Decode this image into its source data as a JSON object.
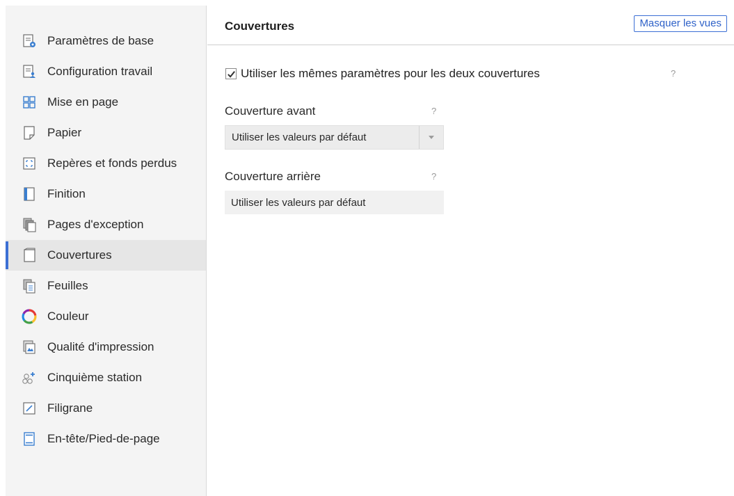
{
  "sidebar": {
    "items": [
      {
        "label": "Paramètres de base",
        "icon": "basic-settings-icon"
      },
      {
        "label": "Configuration travail",
        "icon": "job-config-icon"
      },
      {
        "label": "Mise en page",
        "icon": "layout-grid-icon"
      },
      {
        "label": "Papier",
        "icon": "paper-icon"
      },
      {
        "label": "Repères et fonds perdus",
        "icon": "marks-bleed-icon"
      },
      {
        "label": "Finition",
        "icon": "finishing-icon"
      },
      {
        "label": "Pages d'exception",
        "icon": "exception-pages-icon"
      },
      {
        "label": "Couvertures",
        "icon": "covers-icon",
        "active": true
      },
      {
        "label": "Feuilles",
        "icon": "sheets-icon"
      },
      {
        "label": "Couleur",
        "icon": "color-wheel-icon"
      },
      {
        "label": "Qualité d'impression",
        "icon": "print-quality-icon"
      },
      {
        "label": "Cinquième station",
        "icon": "fifth-station-icon"
      },
      {
        "label": "Filigrane",
        "icon": "watermark-icon"
      },
      {
        "label": "En-tête/Pied-de-page",
        "icon": "header-footer-icon"
      }
    ]
  },
  "main": {
    "title": "Couvertures",
    "hide_views_label": "Masquer les vues",
    "same_settings": {
      "label": "Utiliser les mêmes paramètres pour les deux couvertures",
      "checked": true
    },
    "help_symbol": "?",
    "front_cover": {
      "label": "Couverture avant",
      "value": "Utiliser les valeurs par défaut"
    },
    "back_cover": {
      "label": "Couverture arrière",
      "value": "Utiliser les valeurs par défaut"
    }
  },
  "colors": {
    "accent": "#3b6fd4",
    "sidebar_bg": "#f4f4f4",
    "active_bg": "#e6e6e6"
  }
}
